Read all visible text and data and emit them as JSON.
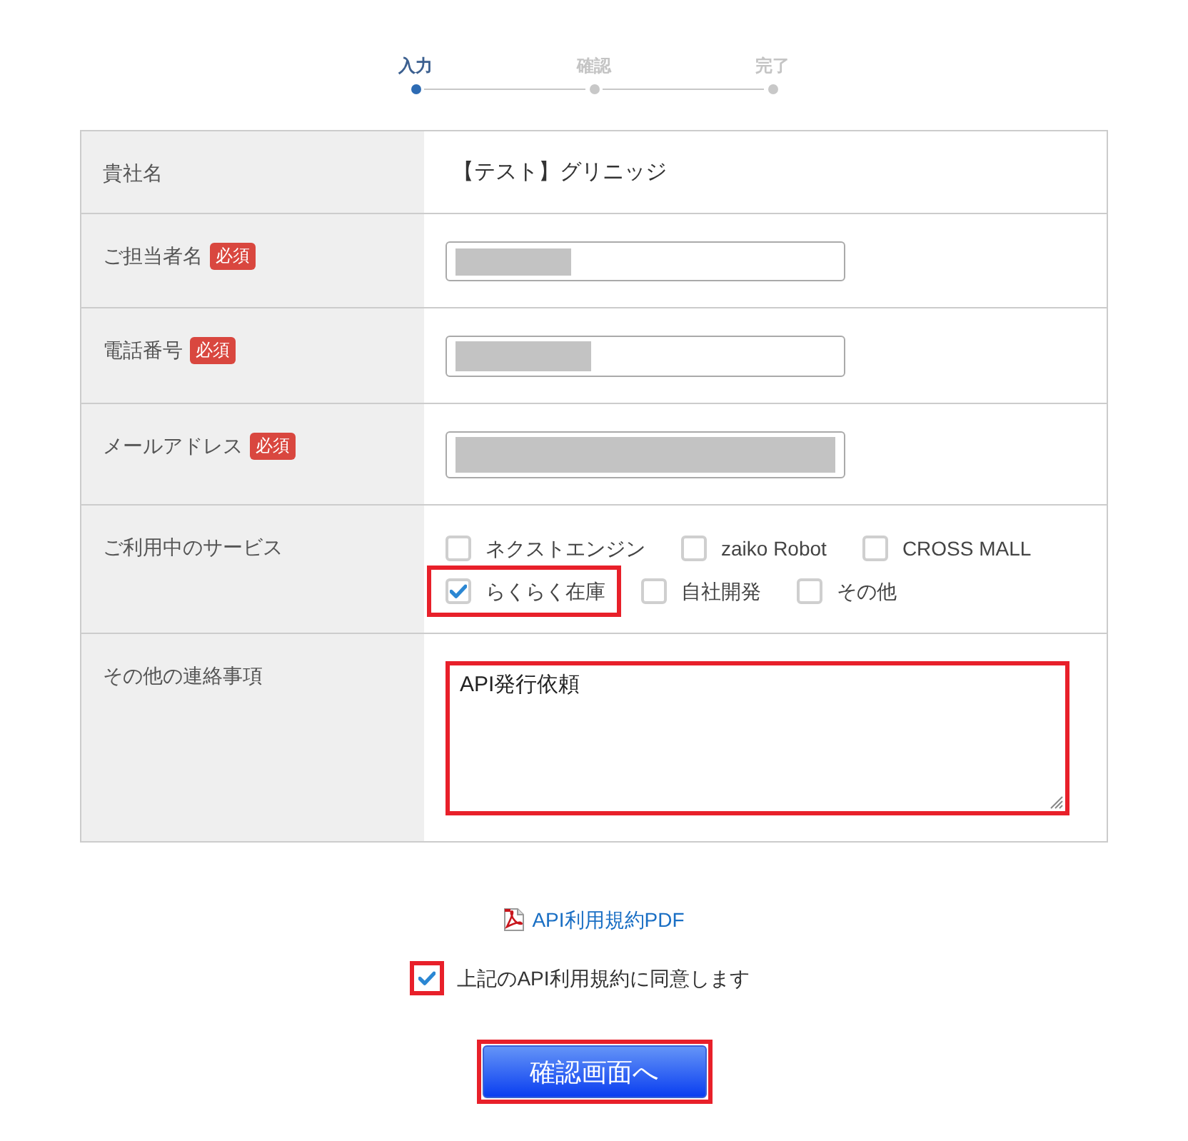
{
  "stepper": {
    "steps": [
      {
        "label": "入力",
        "selected": true
      },
      {
        "label": "確認",
        "selected": false
      },
      {
        "label": "完了",
        "selected": false
      }
    ]
  },
  "form": {
    "rows": [
      {
        "kind": "text",
        "label": "貴社名",
        "value": "【テスト】グリニッジ"
      },
      {
        "kind": "input",
        "label": "ご担当者名",
        "badge": "必須",
        "redacted": true
      },
      {
        "kind": "input",
        "label": "電話番号",
        "badge": "必須",
        "redacted": true
      },
      {
        "kind": "input",
        "label": "メールアドレス",
        "badge": "必須",
        "redacted": true
      },
      {
        "kind": "checkboxes",
        "label": "ご利用中のサービス",
        "options": [
          {
            "label": "ネクストエンジン",
            "checked": false,
            "highlighted": false
          },
          {
            "label": "zaiko Robot",
            "checked": false,
            "highlighted": false
          },
          {
            "label": "CROSS MALL",
            "checked": false,
            "highlighted": false
          },
          {
            "label": "らくらく在庫",
            "checked": true,
            "highlighted": true
          },
          {
            "label": "自社開発",
            "checked": false,
            "highlighted": false
          },
          {
            "label": "その他",
            "checked": false,
            "highlighted": false
          }
        ]
      },
      {
        "kind": "textarea",
        "label": "その他の連絡事項",
        "value": "API発行依頼",
        "highlighted": true
      }
    ]
  },
  "pdf_link": {
    "label": "API利用規約PDF"
  },
  "agreement": {
    "label": "上記のAPI利用規約に同意します",
    "checked": true,
    "highlighted": true
  },
  "submit_button": {
    "label": "確認画面へ",
    "highlighted": true
  }
}
